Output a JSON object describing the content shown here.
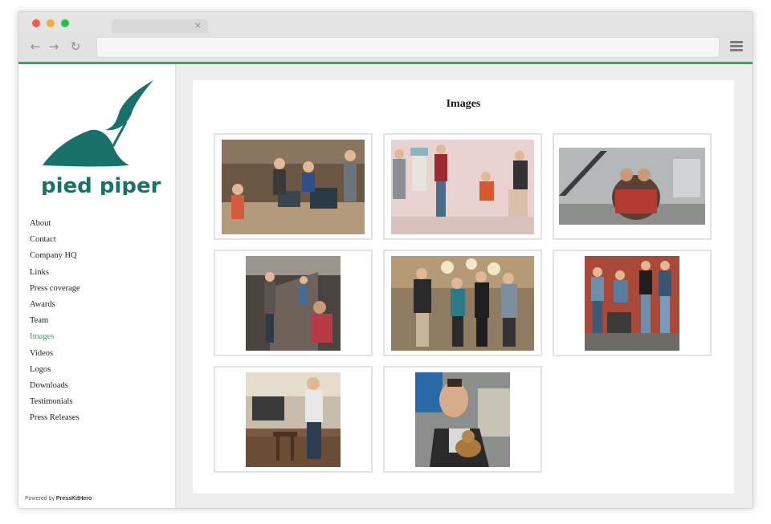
{
  "browser": {
    "tab_close": "×",
    "back": "←",
    "forward": "→",
    "reload": "↻"
  },
  "brand": {
    "name": "pied piper",
    "color": "#19726a"
  },
  "sidebar": {
    "items": [
      {
        "label": "About"
      },
      {
        "label": "Contact"
      },
      {
        "label": "Company HQ"
      },
      {
        "label": "Links"
      },
      {
        "label": "Press coverage"
      },
      {
        "label": "Awards"
      },
      {
        "label": "Team"
      },
      {
        "label": "Images",
        "active": true
      },
      {
        "label": "Videos"
      },
      {
        "label": "Logos"
      },
      {
        "label": "Downloads"
      },
      {
        "label": "Testimonials"
      },
      {
        "label": "Press Releases"
      }
    ],
    "powered_prefix": "Powered by",
    "powered_brand": "PressKitHero"
  },
  "main": {
    "title": "Images"
  },
  "colors": {
    "accent": "#2aae55",
    "brand": "#19726a",
    "text": "#1f1f1f"
  }
}
